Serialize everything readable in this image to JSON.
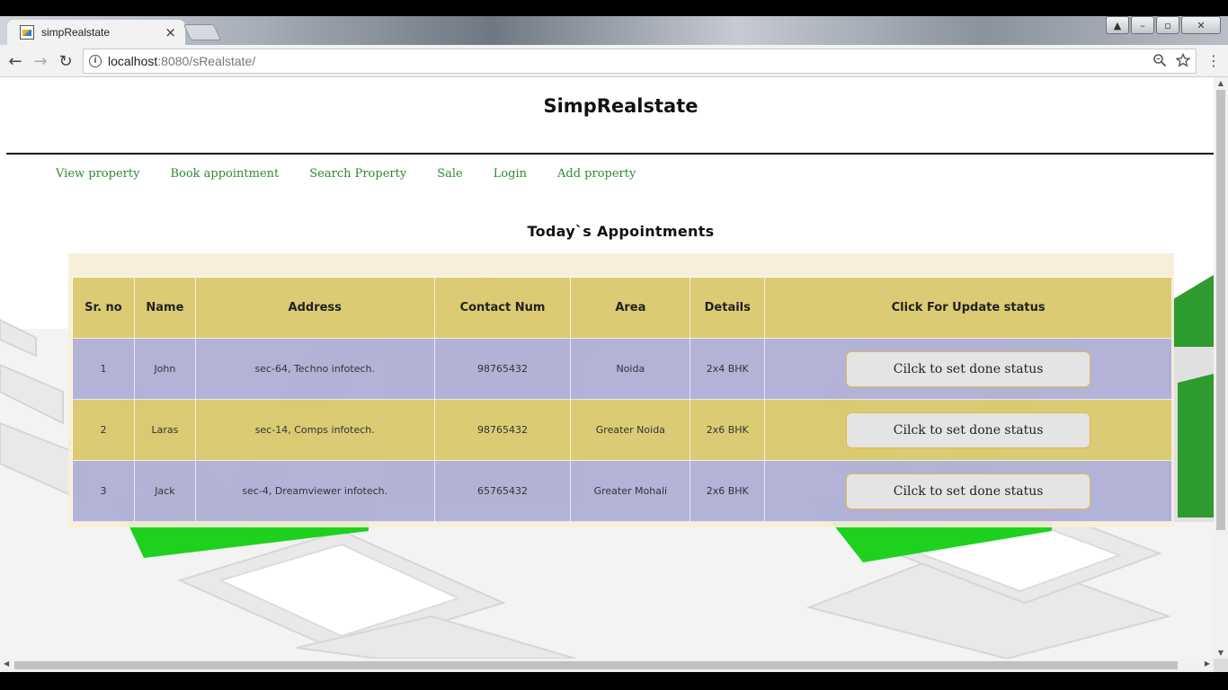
{
  "browser": {
    "tab_title": "simpRealstate",
    "tab_close": "×",
    "url_host": "localhost",
    "url_rest": ":8080/sRealstate/",
    "back_glyph": "←",
    "forward_glyph": "→",
    "reload_glyph": "↻",
    "zoom_icon": "zoom-icon",
    "star_icon": "bookmark-star-icon",
    "menu_glyph": "⋮",
    "window_buttons": [
      "▲",
      "–",
      "▫",
      "✕"
    ]
  },
  "site": {
    "title": "SimpRealstate",
    "nav": [
      "View property",
      "Book appointment",
      "Search Property",
      "Sale",
      "Login",
      "Add property"
    ],
    "nav_color": "#2e8b2e"
  },
  "appointments": {
    "title": "Today`s Appointments",
    "headers": [
      "Sr. no",
      "Name",
      "Address",
      "Contact Num",
      "Area",
      "Details",
      "Click For Update status"
    ],
    "rows": [
      {
        "sr": "1",
        "name": "John",
        "address": "sec-64, Techno infotech.",
        "contact": "98765432",
        "area": "Noida",
        "details": "2x4 BHK",
        "action": "Cilck to set done status"
      },
      {
        "sr": "2",
        "name": "Laras",
        "address": "sec-14, Comps infotech.",
        "contact": "98765432",
        "area": "Greater Noida",
        "details": "2x6 BHK",
        "action": "Cilck to set done status"
      },
      {
        "sr": "3",
        "name": "Jack",
        "address": "sec-4, Dreamviewer infotech.",
        "contact": "65765432",
        "area": "Greater Mohali",
        "details": "2x6 BHK",
        "action": "Cilck to set done status"
      }
    ],
    "colors": {
      "header": "#d6c462",
      "row_odd": "#a8aad6",
      "row_even": "#d6c462",
      "button_border": "#e2b94a"
    }
  }
}
